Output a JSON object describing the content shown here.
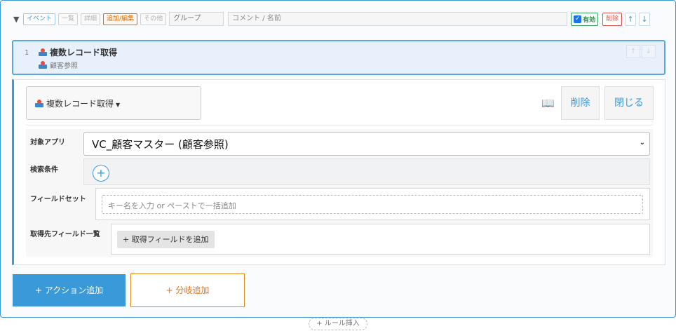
{
  "rule_bar": {
    "caret": "▼",
    "tags": [
      "イベント",
      "一覧",
      "詳細",
      "追加/編集",
      "その他"
    ],
    "group_placeholder": "グループ",
    "comment_placeholder": "コメント / 名前",
    "valid_label": "有効",
    "delete_label": "削除",
    "up_label": "↑",
    "down_label": "↓"
  },
  "action_card": {
    "number": "1",
    "title": "複数レコード取得",
    "subtitle": "顧客参照",
    "up_label": "↑",
    "down_label": "↓"
  },
  "editor": {
    "action_type": "複数レコード取得",
    "delete_label": "削除",
    "close_label": "閉じる",
    "fields": {
      "target_app_label": "対象アプリ",
      "target_app_value": "VC_顧客マスター (顧客参照)",
      "search_condition_label": "検索条件",
      "field_set_label": "フィールドセット",
      "field_set_placeholder": "キー名を入力 or ペーストで一括追加",
      "target_fields_label": "取得先フィールド一覧",
      "add_field_label": "+ 取得フィールドを追加"
    }
  },
  "bottom": {
    "add_action_label": "+ アクション追加",
    "add_branch_label": "+ 分岐追加",
    "rule_insert_label": "+ ルール挿入"
  },
  "colors": {
    "accent": "#3a9ad9",
    "branch": "#e0701e",
    "danger": "#d9534f",
    "valid": "#2e8b4e"
  }
}
